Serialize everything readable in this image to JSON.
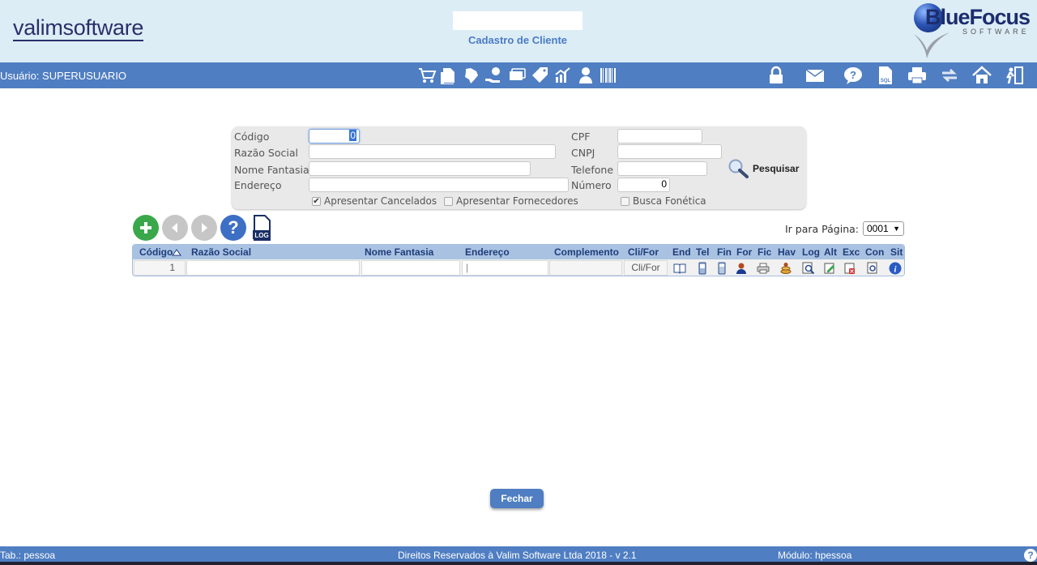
{
  "header": {
    "brand": "valimsoftware",
    "title": "Cadastro de Cliente",
    "partner_brand": "BlueFocus",
    "partner_sub": "SOFTWARE"
  },
  "navbar": {
    "user": "Usuário: SUPERUSUARIO",
    "icons": [
      "cart-icon",
      "documents-icon",
      "brazil-map-icon",
      "money-hand-icon",
      "cards-icon",
      "tag-money-icon",
      "chart-icon",
      "person-icon",
      "barcode-icon",
      "lock-icon",
      "mail-icon",
      "chat-help-icon",
      "sql-icon",
      "printer-icon",
      "refresh-icon",
      "home-icon",
      "exit-icon"
    ]
  },
  "form": {
    "codigo_label": "Código",
    "codigo_value": "0",
    "razao_label": "Razão Social",
    "fantasia_label": "Nome Fantasia",
    "endereco_label": "Endereço",
    "cpf_label": "CPF",
    "cnpj_label": "CNPJ",
    "telefone_label": "Telefone",
    "numero_label": "Número",
    "numero_value": "0",
    "chk_cancelados": "Apresentar Cancelados",
    "chk_fornecedores": "Apresentar Fornecedores",
    "chk_fonetica": "Busca Fonética",
    "search_label": "Pesquisar"
  },
  "pager": {
    "label": "Ir para Página:",
    "value": "0001"
  },
  "grid": {
    "headers": {
      "codigo": "Código",
      "razao": "Razão Social",
      "fantasia": "Nome Fantasia",
      "endereco": "Endereço",
      "complemento": "Complemento",
      "clifor": "Cli/For",
      "end": "End",
      "tel": "Tel",
      "fin": "Fin",
      "for": "For",
      "fic": "Fic",
      "hav": "Hav",
      "log": "Log",
      "alt": "Alt",
      "exc": "Exc",
      "con": "Con",
      "sit": "Sit"
    },
    "row": {
      "codigo": "1",
      "clifor": "Cli/For"
    }
  },
  "buttons": {
    "fechar": "Fechar",
    "log": "LOG"
  },
  "footer": {
    "tab": "Tab.: pessoa",
    "copyright": "Direitos Reservados à Valim Software Ltda 2018 - v 2.1",
    "modulo": "Módulo: hpessoa",
    "help": "?"
  },
  "colors": {
    "navbar": "#4f7ec2",
    "header_bg": "#dcedf6",
    "grid_head": "#a9c2e2",
    "add_green": "#3aa84a",
    "help_blue": "#3d6fc4"
  }
}
